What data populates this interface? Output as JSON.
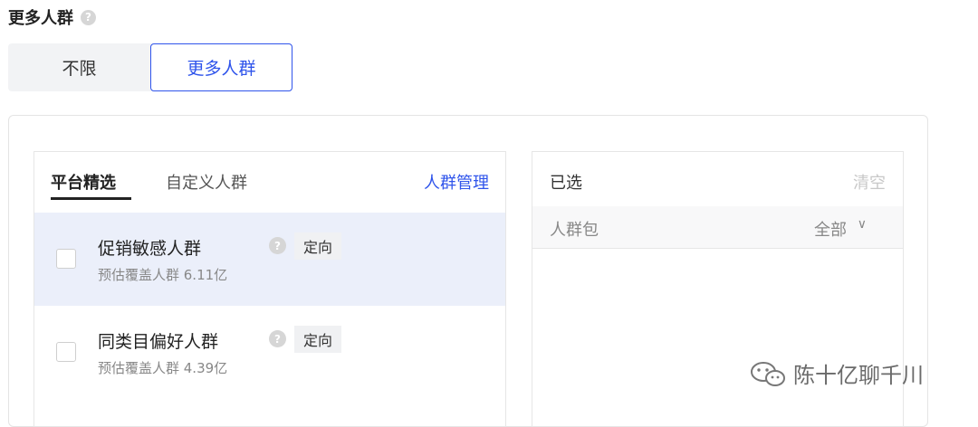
{
  "section": {
    "title": "更多人群"
  },
  "segment": {
    "options": [
      "不限",
      "更多人群"
    ],
    "selected": "更多人群"
  },
  "left_panel": {
    "tabs": [
      "平台精选",
      "自定义人群"
    ],
    "active_tab": "平台精选",
    "manage_link": "人群管理",
    "items": [
      {
        "name": "促销敏感人群",
        "coverage": "预估覆盖人群 6.11亿",
        "tag": "定向"
      },
      {
        "name": "同类目偏好人群",
        "coverage": "预估覆盖人群 4.39亿",
        "tag": "定向"
      }
    ]
  },
  "right_panel": {
    "title": "已选",
    "clear_label": "清空",
    "column": "人群包",
    "filter_value": "全部"
  },
  "watermark": {
    "text": "陈十亿聊千川"
  },
  "colors": {
    "accent": "#2f54eb",
    "highlight_row": "#ebeffa"
  }
}
